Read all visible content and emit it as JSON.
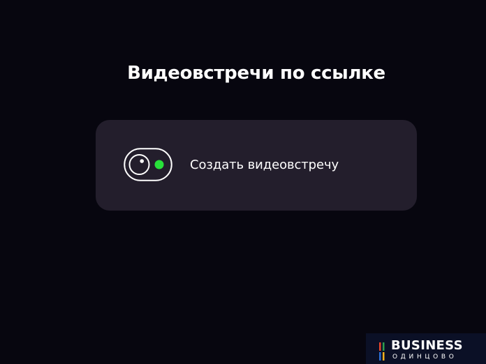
{
  "page": {
    "title": "Видеовстречи по ссылке"
  },
  "create_card": {
    "label": "Создать видеовстречу",
    "icon": "video-camera-icon",
    "accent_color": "#28e03a"
  },
  "watermark": {
    "title": "BUSINESS",
    "subtitle": "ОДИНЦОВО"
  },
  "colors": {
    "background": "#07060f",
    "card": "#231e2c"
  }
}
